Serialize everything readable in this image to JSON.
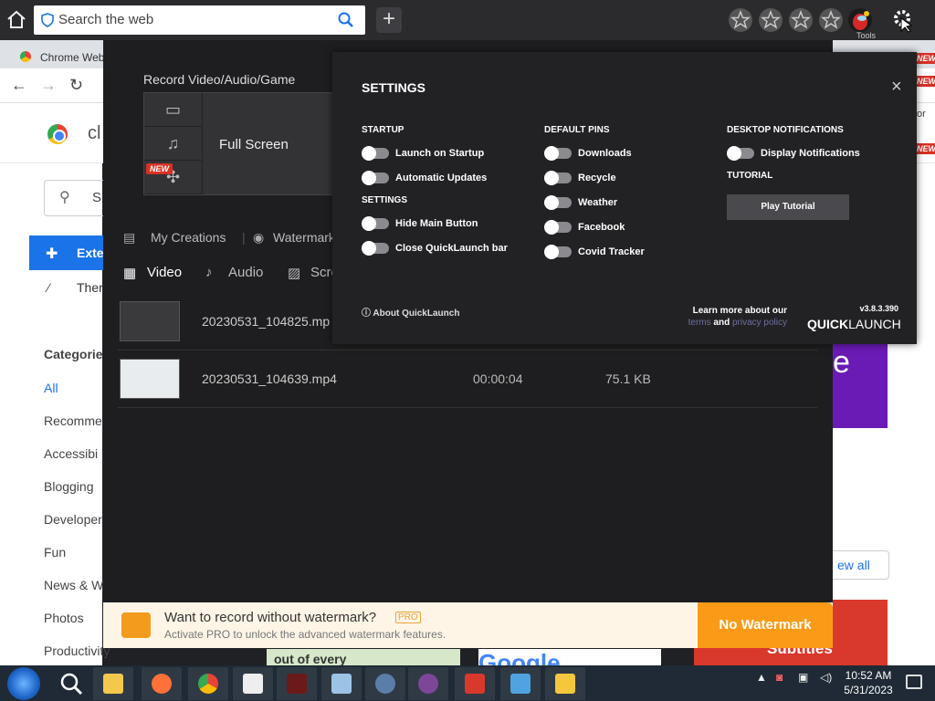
{
  "topbar": {
    "search_placeholder": "Search the web",
    "tools_label": "Tools"
  },
  "chrome": {
    "tab_title": "Chrome Web",
    "new_badge": "NEW",
    "store_title": "cl",
    "search_stub": "S",
    "sidebar": {
      "extensions": "Exte",
      "themes": "Ther",
      "categories_heading": "Categorie",
      "items": [
        "All",
        "Recomme",
        "Accessibi",
        "Blogging",
        "Developer",
        "Fun",
        "News & W",
        "Photos",
        "Productivity"
      ]
    },
    "right": {
      "purple_letter": "e",
      "view_all": "ew all",
      "red_card_text": "Subtitles",
      "or_text": "or"
    },
    "strip_text": "out of every",
    "google_text": "Google"
  },
  "recorder": {
    "section_title": "Record Video/Audio/Game",
    "mode_label": "Full Screen",
    "new_badge": "NEW",
    "nav": {
      "my_creations": "My Creations",
      "watermark": "Watermark"
    },
    "media_tabs": {
      "video": "Video",
      "audio": "Audio",
      "screenshot": "Scre"
    },
    "recordings": [
      {
        "filename": "20230531_104825.mp",
        "duration": "",
        "size": ""
      },
      {
        "filename": "20230531_104639.mp4",
        "duration": "00:00:04",
        "size": "75.1 KB"
      }
    ],
    "promo": {
      "title": "Want to record without watermark?",
      "pro": "PRO",
      "subtitle": "Activate PRO to unlock the advanced watermark features.",
      "button": "No Watermark"
    }
  },
  "settings": {
    "title": "SETTINGS",
    "close": "×",
    "startup_heading": "STARTUP",
    "startup_options": [
      "Launch on Startup",
      "Automatic Updates"
    ],
    "settings_heading": "SETTINGS",
    "settings_options": [
      "Hide Main Button",
      "Close QuickLaunch bar"
    ],
    "pins_heading": "DEFAULT PINS",
    "pins_options": [
      "Downloads",
      "Recycle",
      "Weather",
      "Facebook",
      "Covid Tracker"
    ],
    "desktop_heading": "DESKTOP NOTIFICATIONS",
    "desktop_options": [
      "Display Notifications"
    ],
    "tutorial_heading": "TUTORIAL",
    "play_tutorial": "Play Tutorial",
    "about": "About QuickLaunch",
    "learn_more": "Learn more about our",
    "terms": "terms",
    "and": "and",
    "privacy": "privacy policy",
    "version": "v3.8.3.390",
    "brand_bold": "QUICK",
    "brand_normal": "LAUNCH"
  },
  "taskbar": {
    "time": "10:52 AM",
    "date": "5/31/2023",
    "tray_arrow": "▲"
  },
  "colors": {
    "accent_orange": "#f99b16",
    "chrome_blue": "#1a73e8",
    "settings_bg": "#222225"
  }
}
